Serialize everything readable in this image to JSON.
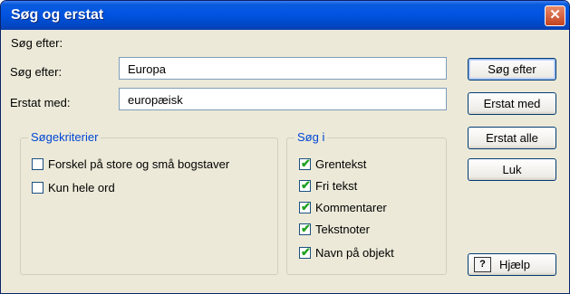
{
  "window": {
    "title": "Søg og erstat"
  },
  "find": {
    "label": "Søg efter:",
    "value": "Europa"
  },
  "replace": {
    "label": "Erstat med:",
    "value": "europæisk"
  },
  "criteria": {
    "legend": "Søgekriterier",
    "options": [
      {
        "label": "Forskel på store og små bogstaver",
        "checked": false
      },
      {
        "label": "Kun hele ord",
        "checked": false
      }
    ]
  },
  "search_in": {
    "legend": "Søg i",
    "options": [
      {
        "label": "Grentekst",
        "checked": true
      },
      {
        "label": "Fri tekst",
        "checked": true
      },
      {
        "label": "Kommentarer",
        "checked": true
      },
      {
        "label": "Tekstnoter",
        "checked": true
      },
      {
        "label": "Navn på objekt",
        "checked": true
      }
    ]
  },
  "buttons": {
    "find": "Søg efter",
    "replace": "Erstat med",
    "replace_all": "Erstat alle",
    "close": "Luk",
    "help": "Hjælp"
  }
}
